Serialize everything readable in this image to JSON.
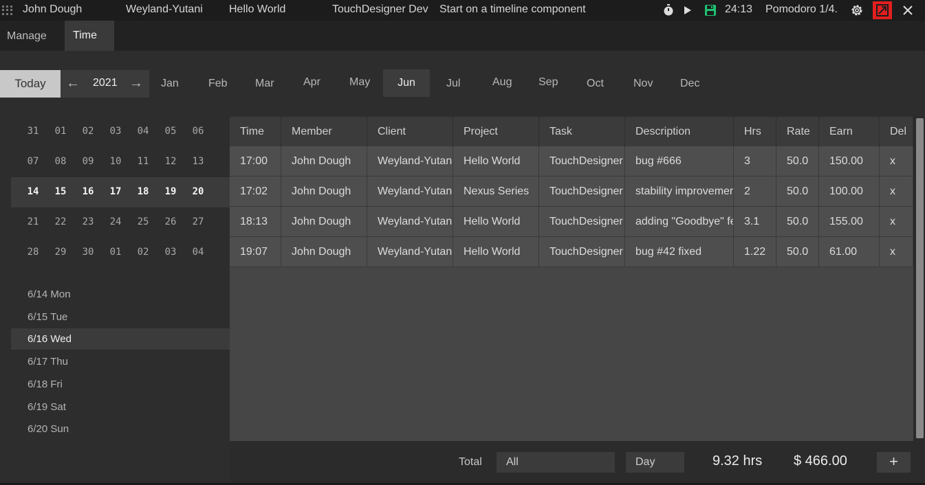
{
  "topbar": {
    "user": "John Dough",
    "client": "Weyland-Yutani",
    "project": "Hello World",
    "task": "TouchDesigner Dev",
    "description": "Start on a timeline component",
    "timer": "24:13",
    "pomodoro": "Pomodoro 1/4.",
    "icons": [
      "grip-icon",
      "stopwatch-icon",
      "play-icon",
      "save-icon",
      "settings-icon",
      "shrink-icon",
      "close-icon"
    ],
    "colors": {
      "save": "#1ec271",
      "shrink_highlight": "#e21f1f"
    }
  },
  "tabs": [
    {
      "label": "Manage"
    },
    {
      "label": "Time"
    }
  ],
  "active_tab": "Time",
  "nav": {
    "today": "Today",
    "year": "2021",
    "months": [
      "Jan",
      "Feb",
      "Mar",
      "Apr",
      "May",
      "Jun",
      "Jul",
      "Aug",
      "Sep",
      "Oct",
      "Nov",
      "Dec"
    ],
    "active_month": "Jun"
  },
  "calendar": {
    "weeks": [
      [
        "31",
        "01",
        "02",
        "03",
        "04",
        "05",
        "06"
      ],
      [
        "07",
        "08",
        "09",
        "10",
        "11",
        "12",
        "13"
      ],
      [
        "14",
        "15",
        "16",
        "17",
        "18",
        "19",
        "20"
      ],
      [
        "21",
        "22",
        "23",
        "24",
        "25",
        "26",
        "27"
      ],
      [
        "28",
        "29",
        "30",
        "01",
        "02",
        "03",
        "04"
      ]
    ],
    "active_week": 2
  },
  "days": [
    {
      "label": "6/14 Mon"
    },
    {
      "label": "6/15 Tue"
    },
    {
      "label": "6/16 Wed"
    },
    {
      "label": "6/17 Thu"
    },
    {
      "label": "6/18 Fri"
    },
    {
      "label": "6/19 Sat"
    },
    {
      "label": "6/20 Sun"
    }
  ],
  "active_day": 2,
  "table": {
    "headers": [
      "Time",
      "Member",
      "Client",
      "Project",
      "Task",
      "Description",
      "Hrs",
      "Rate",
      "Earn",
      "Del"
    ],
    "rows": [
      [
        "17:00",
        "John Dough",
        "Weyland-Yutani",
        "Hello World",
        "TouchDesigner",
        "bug #666",
        "3",
        "50.0",
        "150.00",
        "x"
      ],
      [
        "17:02",
        "John Dough",
        "Weyland-Yutani",
        "Nexus Series",
        "TouchDesigner",
        "stability improvemer",
        "2",
        "50.0",
        "100.00",
        "x"
      ],
      [
        "18:13",
        "John Dough",
        "Weyland-Yutani",
        "Hello World",
        "TouchDesigner",
        "adding \"Goodbye\" fe",
        "3.1",
        "50.0",
        "155.00",
        "x"
      ],
      [
        "19:07",
        "John Dough",
        "Weyland-Yutani",
        "Hello World",
        "TouchDesigner",
        "bug #42 fixed",
        "1.22",
        "50.0",
        "61.00",
        "x"
      ]
    ]
  },
  "footer": {
    "total_label": "Total",
    "filter": "All",
    "period": "Day",
    "hours": "9.32 hrs",
    "earnings": "$ 466.00",
    "add": "+"
  }
}
